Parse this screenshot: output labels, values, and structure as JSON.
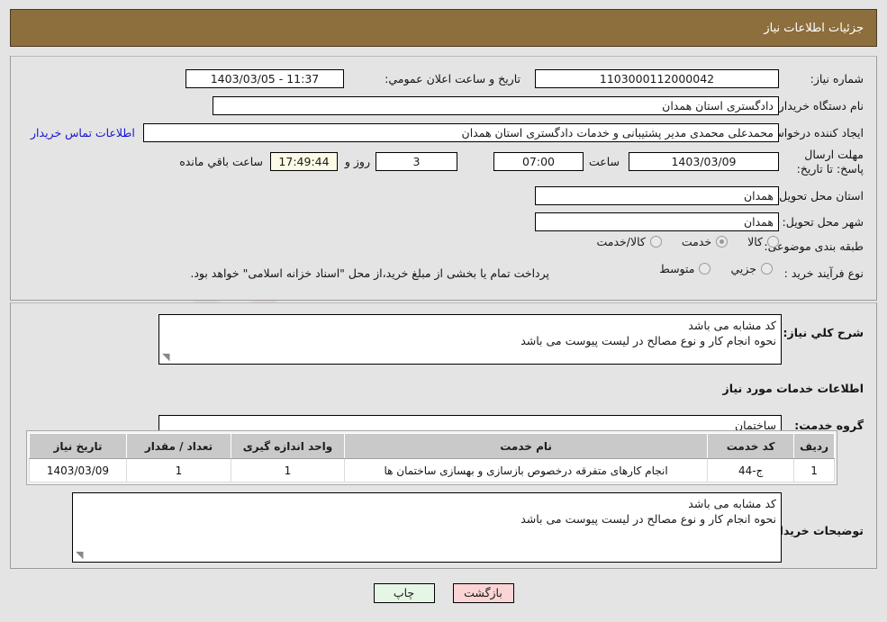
{
  "header": {
    "title": "جزئیات اطلاعات نیاز"
  },
  "top_form": {
    "need_number": {
      "label": "شماره نیاز:",
      "value": "1103000112000042"
    },
    "announce_datetime": {
      "label": "تاریخ و ساعت اعلان عمومي:",
      "value": "11:37 - 1403/03/05"
    },
    "buyer_org": {
      "label": "نام دستگاه خریدار:",
      "value": "دادگستری استان همدان"
    },
    "requester": {
      "label": "ایجاد کننده درخواست:",
      "value": "محمدعلی محمدی مدیر پشتیبانی و خدمات دادگستری استان همدان"
    },
    "buyer_contact_link": "اطلاعات تماس خریدار",
    "deadline": {
      "label": "مهلت ارسال پاسخ: تا تاریخ:",
      "date": "1403/03/09",
      "hour_label": "ساعت",
      "hour": "07:00",
      "days": "3",
      "days_label": "روز و",
      "countdown": "17:49:44",
      "countdown_label": "ساعت باقي مانده"
    },
    "delivery_province": {
      "label": "استان محل تحویل:",
      "value": "همدان"
    },
    "delivery_city": {
      "label": "شهر محل تحویل:",
      "value": "همدان"
    },
    "category": {
      "label": "طبقه بندی موضوعی:",
      "options": [
        {
          "label": "کالا",
          "selected": false
        },
        {
          "label": "خدمت",
          "selected": true
        },
        {
          "label": "کالا/خدمت",
          "selected": false
        }
      ]
    },
    "purchase_type": {
      "label": "نوع فرآیند خرید :",
      "options": [
        {
          "label": "جزیي",
          "selected": false
        },
        {
          "label": "متوسط",
          "selected": false
        }
      ],
      "note": "پرداخت تمام یا بخشی از مبلغ خرید،از محل \"اسناد خزانه اسلامی\" خواهد بود."
    }
  },
  "mid_form": {
    "general_desc": {
      "label": "شرح کلي نیاز:",
      "value": "کد مشابه می باشد\nنحوه انجام کار و نوع مصالح در لیست پیوست می باشد"
    },
    "services_title": "اطلاعات خدمات مورد نیاز",
    "service_group": {
      "label": "گروه خدمت:",
      "value": "ساختمان"
    },
    "table": {
      "columns": [
        "ردیف",
        "کد خدمت",
        "نام خدمت",
        "واحد اندازه گیری",
        "تعداد / مقدار",
        "تاریخ نیاز"
      ],
      "rows": [
        [
          "1",
          "ج-44",
          "انجام کارهای متفرقه درخصوص بازسازی و بهسازی ساختمان ها",
          "1",
          "1",
          "1403/03/09"
        ]
      ]
    },
    "buyer_notes": {
      "label": "توضیحات خریدار:",
      "value": "کد مشابه می باشد\nنحوه انجام کار و نوع مصالح در لیست پیوست می باشد"
    }
  },
  "footer": {
    "print_label": "چاپ",
    "back_label": "بازگشت"
  },
  "watermark": {
    "text": "AriaTender.net"
  },
  "colors": {
    "header_bg": "#8d6e3d",
    "page_bg": "#e4e4e4",
    "link": "#1414d2",
    "countdown_bg": "#fbfbe6",
    "print_btn_bg": "#e6f6e6",
    "back_btn_bg": "#fbd5d5",
    "table_header_bg": "#c9c9c9"
  }
}
